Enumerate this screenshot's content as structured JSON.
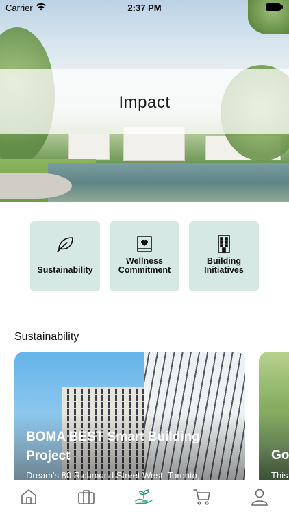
{
  "status_bar": {
    "carrier": "Carrier",
    "time": "2:37 PM"
  },
  "hero": {
    "title": "Impact"
  },
  "categories": [
    {
      "label_line1": "Sustainability",
      "label_line2": "",
      "icon": "leaf-icon"
    },
    {
      "label_line1": "Wellness",
      "label_line2": "Commitment",
      "icon": "heart-book-icon"
    },
    {
      "label_line1": "Building",
      "label_line2": "Initiatives",
      "icon": "building-icon"
    }
  ],
  "section": {
    "title": "Sustainability"
  },
  "cards": [
    {
      "title": "BOMA BEST Smart Building Project",
      "subtitle": "Dream's 80 Richmond Street West, Toronto,"
    },
    {
      "title": "Go",
      "subtitle": "This"
    }
  ],
  "tabbar": {
    "items": [
      "home-icon",
      "briefcase-icon",
      "plant-hand-icon",
      "cart-icon",
      "person-icon"
    ],
    "active_index": 2,
    "active_color": "#2f9e7e",
    "inactive_color": "#6b6b6b"
  },
  "colors": {
    "tile_background": "#d6e8e4",
    "accent": "#2f9e7e"
  }
}
